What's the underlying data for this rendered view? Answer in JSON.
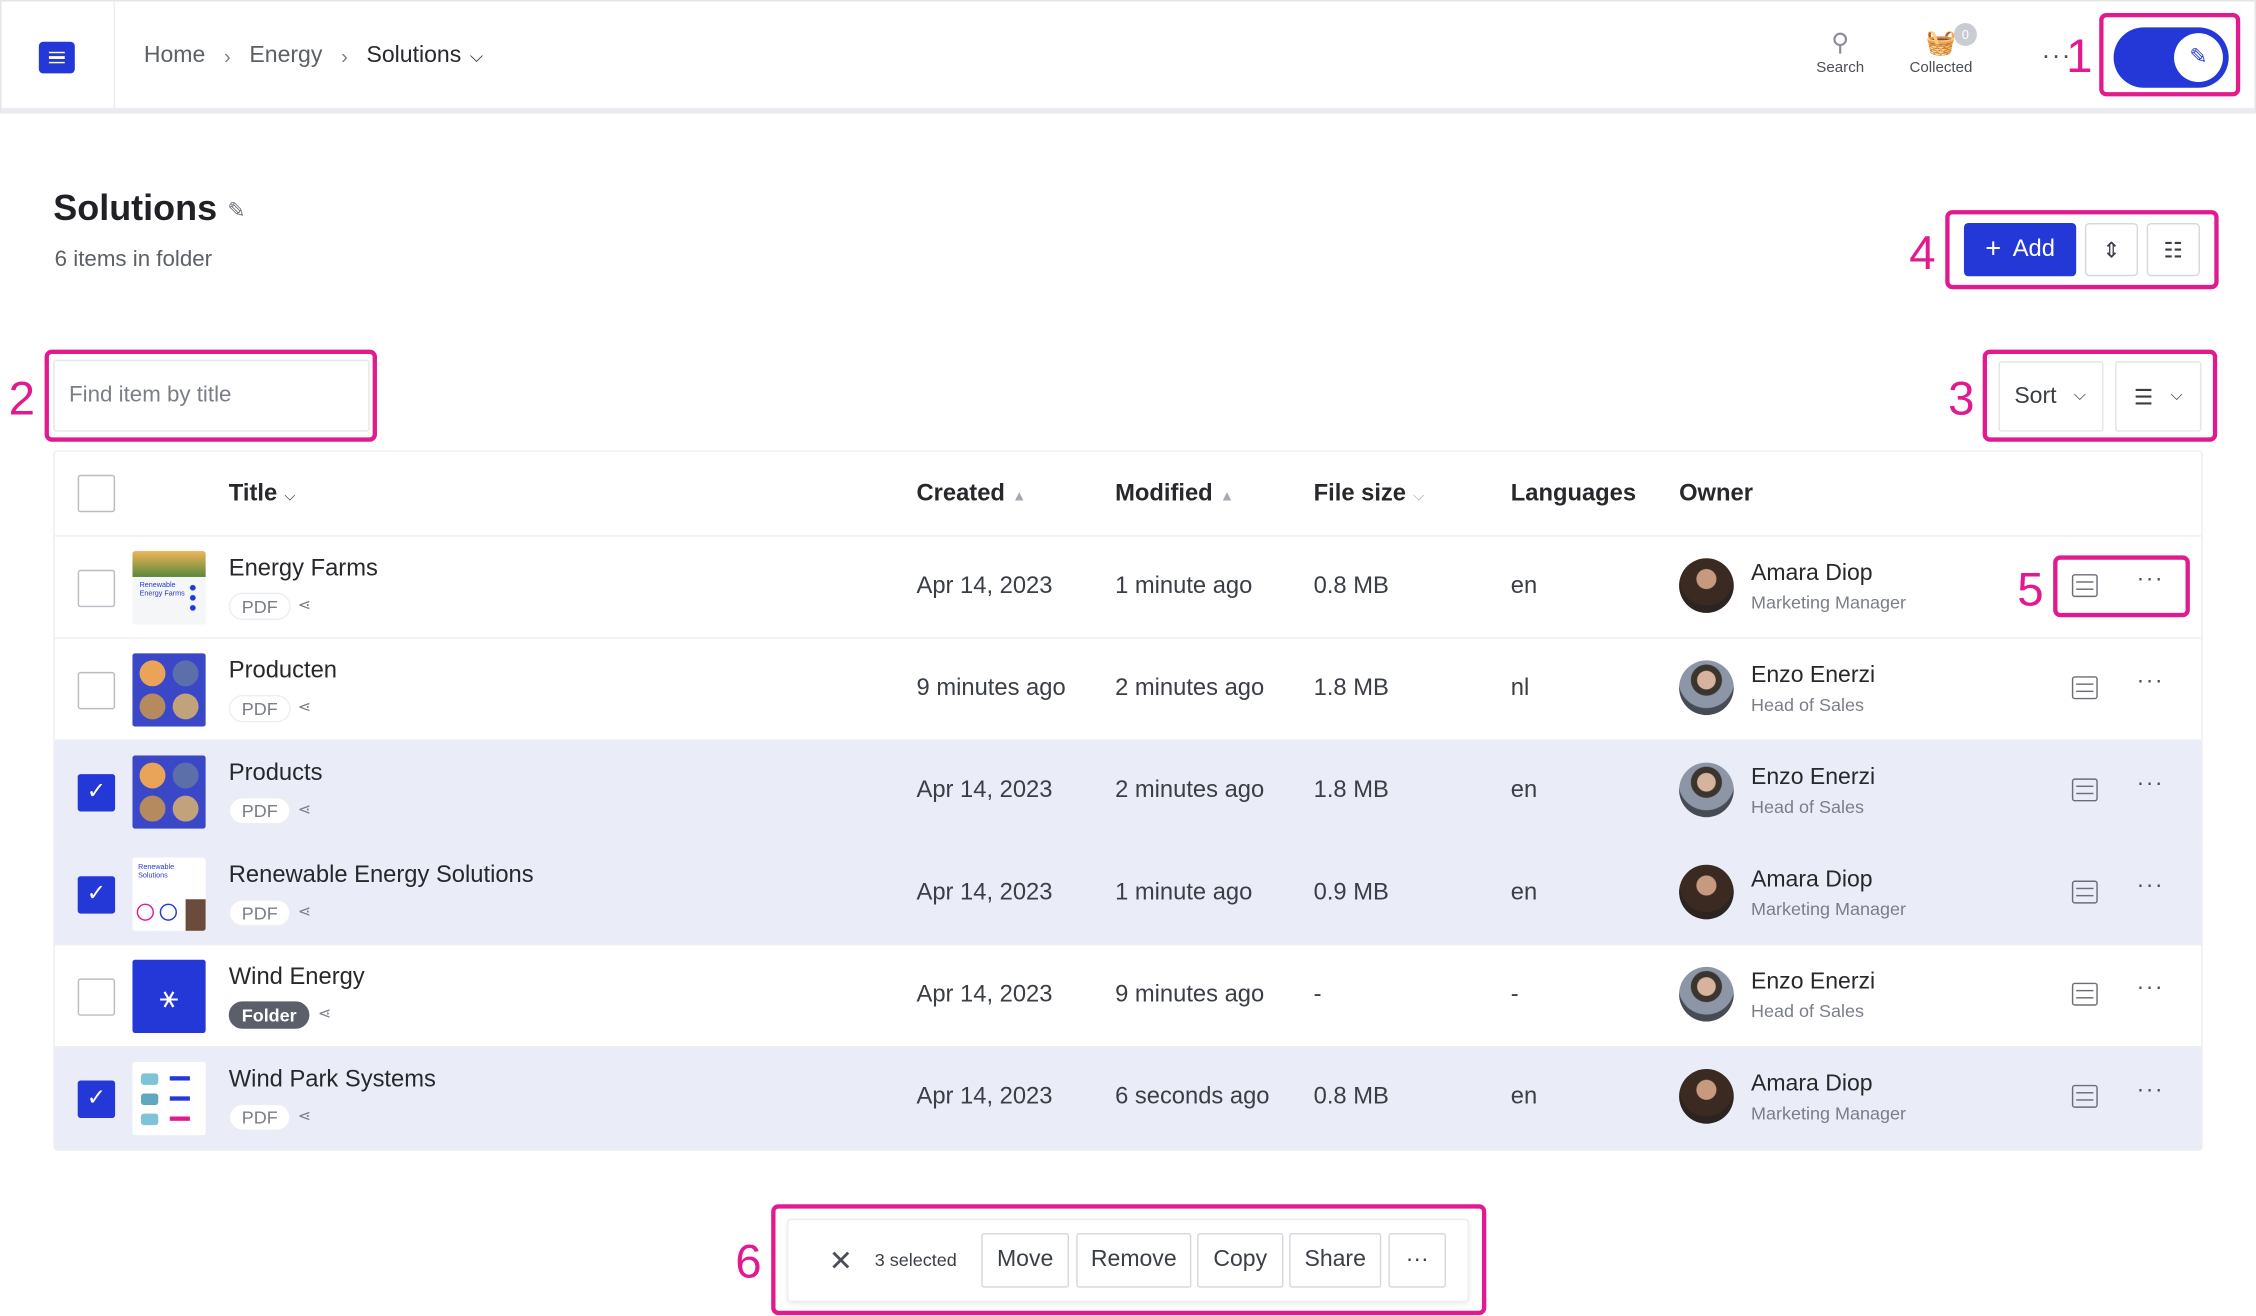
{
  "breadcrumb": [
    "Home",
    "Energy",
    "Solutions"
  ],
  "toolbar": {
    "search_label": "Search",
    "collected_label": "Collected",
    "collected_count": "0",
    "more_label": "···"
  },
  "page": {
    "title": "Solutions",
    "subtitle": "6 items in folder",
    "add_label": "Add",
    "search_placeholder": "Find item by title",
    "sort_label": "Sort"
  },
  "table": {
    "columns": [
      "Title",
      "Created",
      "Modified",
      "File size",
      "Languages",
      "Owner"
    ],
    "rows": [
      {
        "title": "Energy Farms",
        "type": "PDF",
        "created": "Apr 14, 2023",
        "modified": "1 minute ago",
        "size": "0.8 MB",
        "lang": "en",
        "owner": "Amara Diop",
        "role": "Marketing Manager",
        "selected": false
      },
      {
        "title": "Producten",
        "type": "PDF",
        "created": "9 minutes ago",
        "modified": "2 minutes ago",
        "size": "1.8 MB",
        "lang": "nl",
        "owner": "Enzo Enerzi",
        "role": "Head of Sales",
        "selected": false
      },
      {
        "title": "Products",
        "type": "PDF",
        "created": "Apr 14, 2023",
        "modified": "2 minutes ago",
        "size": "1.8 MB",
        "lang": "en",
        "owner": "Enzo Enerzi",
        "role": "Head of Sales",
        "selected": true
      },
      {
        "title": "Renewable Energy Solutions",
        "type": "PDF",
        "created": "Apr 14, 2023",
        "modified": "1 minute ago",
        "size": "0.9 MB",
        "lang": "en",
        "owner": "Amara Diop",
        "role": "Marketing Manager",
        "selected": true
      },
      {
        "title": "Wind Energy",
        "type": "Folder",
        "created": "Apr 14, 2023",
        "modified": "9 minutes ago",
        "size": "-",
        "lang": "-",
        "owner": "Enzo Enerzi",
        "role": "Head of Sales",
        "selected": false
      },
      {
        "title": "Wind Park Systems",
        "type": "PDF",
        "created": "Apr 14, 2023",
        "modified": "6 seconds ago",
        "size": "0.8 MB",
        "lang": "en",
        "owner": "Amara Diop",
        "role": "Marketing Manager",
        "selected": true
      }
    ]
  },
  "bulk": {
    "count": "3 selected",
    "actions": [
      "Move",
      "Remove",
      "Copy",
      "Share"
    ],
    "more_label": "···"
  },
  "annotations": [
    "1",
    "2",
    "3",
    "4",
    "5",
    "6"
  ],
  "colors": {
    "accent": "#2438d8",
    "highlight": "#e21a8f",
    "selected_row": "#eaedf7"
  }
}
